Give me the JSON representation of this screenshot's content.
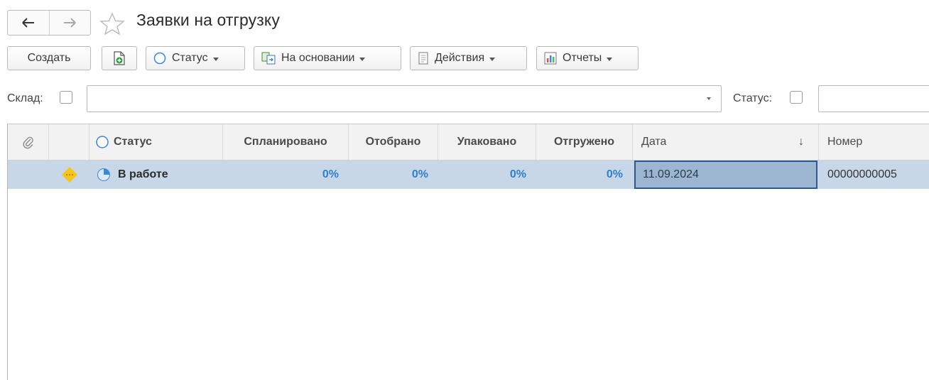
{
  "header": {
    "title": "Заявки на отгрузку",
    "back_icon": "arrow-left-icon",
    "forward_icon": "arrow-right-icon",
    "favorite_icon": "star-icon"
  },
  "toolbar": {
    "create_label": "Создать",
    "status_label": "Статус",
    "based_on_label": "На основании",
    "actions_label": "Действия",
    "reports_label": "Отчеты"
  },
  "filters": {
    "warehouse_label": "Склад:",
    "status_label": "Статус:"
  },
  "table": {
    "columns": {
      "status": "Статус",
      "planned": "Спланировано",
      "picked": "Отобрано",
      "packed": "Упаковано",
      "shipped": "Отгружено",
      "date": "Дата",
      "number": "Номер"
    },
    "sort_indicator": "↓",
    "rows": [
      {
        "status": "В работе",
        "planned": "0%",
        "picked": "0%",
        "packed": "0%",
        "shipped": "0%",
        "date": "11.09.2024",
        "number": "00000000005"
      }
    ]
  },
  "colors": {
    "selected_row": "#c7d7e7",
    "selected_cell": "#9cb6d2",
    "percent_text": "#2e7fd4",
    "status_icon": "#f5c518"
  }
}
